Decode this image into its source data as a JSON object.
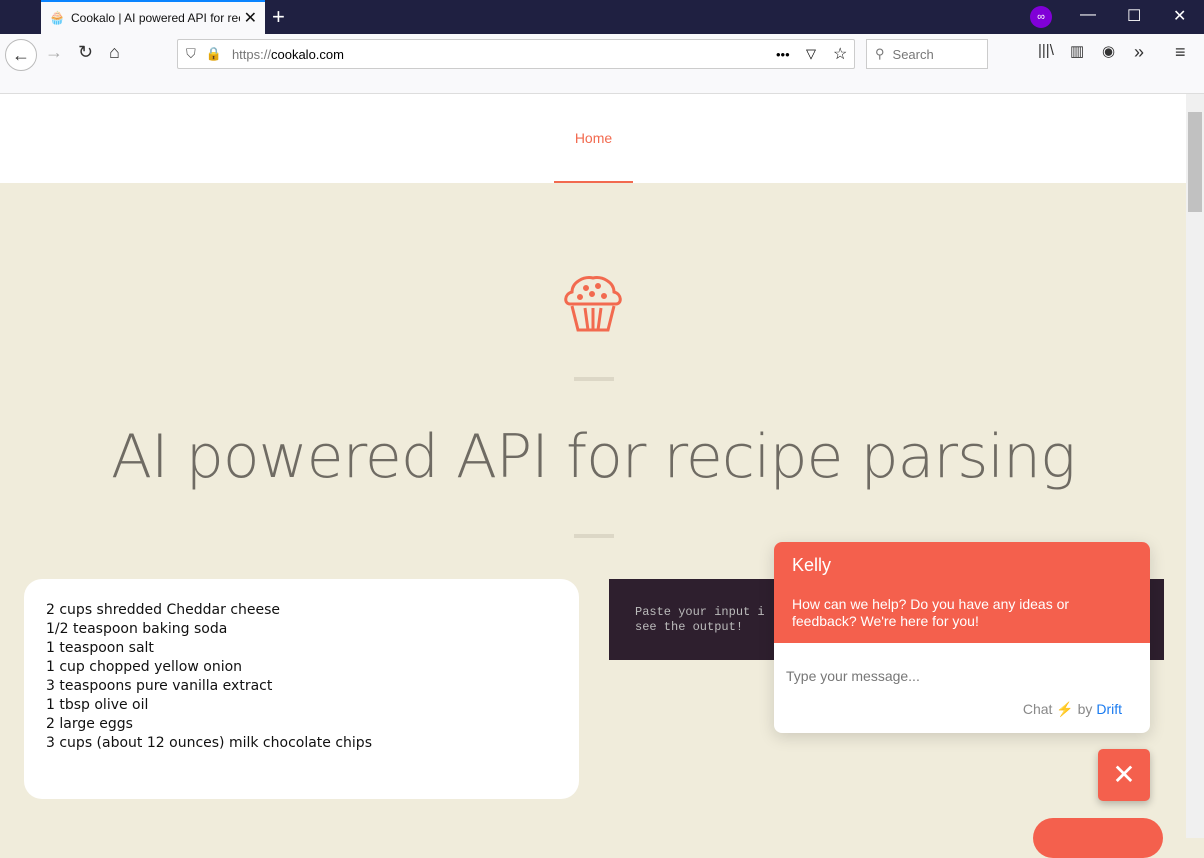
{
  "browser": {
    "tab_title": "Cookalo | AI powered API for recipe parsing",
    "url_scheme": "https://",
    "url_host": "cookalo.com",
    "search_placeholder": "Search"
  },
  "nav": {
    "home": "Home"
  },
  "hero": {
    "title": "AI powered API for recipe parsing"
  },
  "input": {
    "lines": [
      "2 cups shredded Cheddar cheese",
      "1/2 teaspoon baking soda",
      "1 teaspoon salt",
      "1 cup chopped yellow onion",
      "3 teaspoons pure vanilla extract",
      "1 tbsp olive oil",
      "2 large eggs",
      "3 cups (about 12 ounces) milk chocolate chips"
    ]
  },
  "output": {
    "line1": "Paste your input i",
    "line2": "see the output!"
  },
  "chat": {
    "name": "Kelly",
    "message": "How can we help? Do you have any ideas or feedback? We're here for you!",
    "placeholder": "Type your message...",
    "chat": "Chat",
    "by": "by",
    "drift": "Drift"
  },
  "colors": {
    "accent": "#f4604d",
    "background": "#f0ecdb",
    "output_bg": "#2e1f2e"
  }
}
